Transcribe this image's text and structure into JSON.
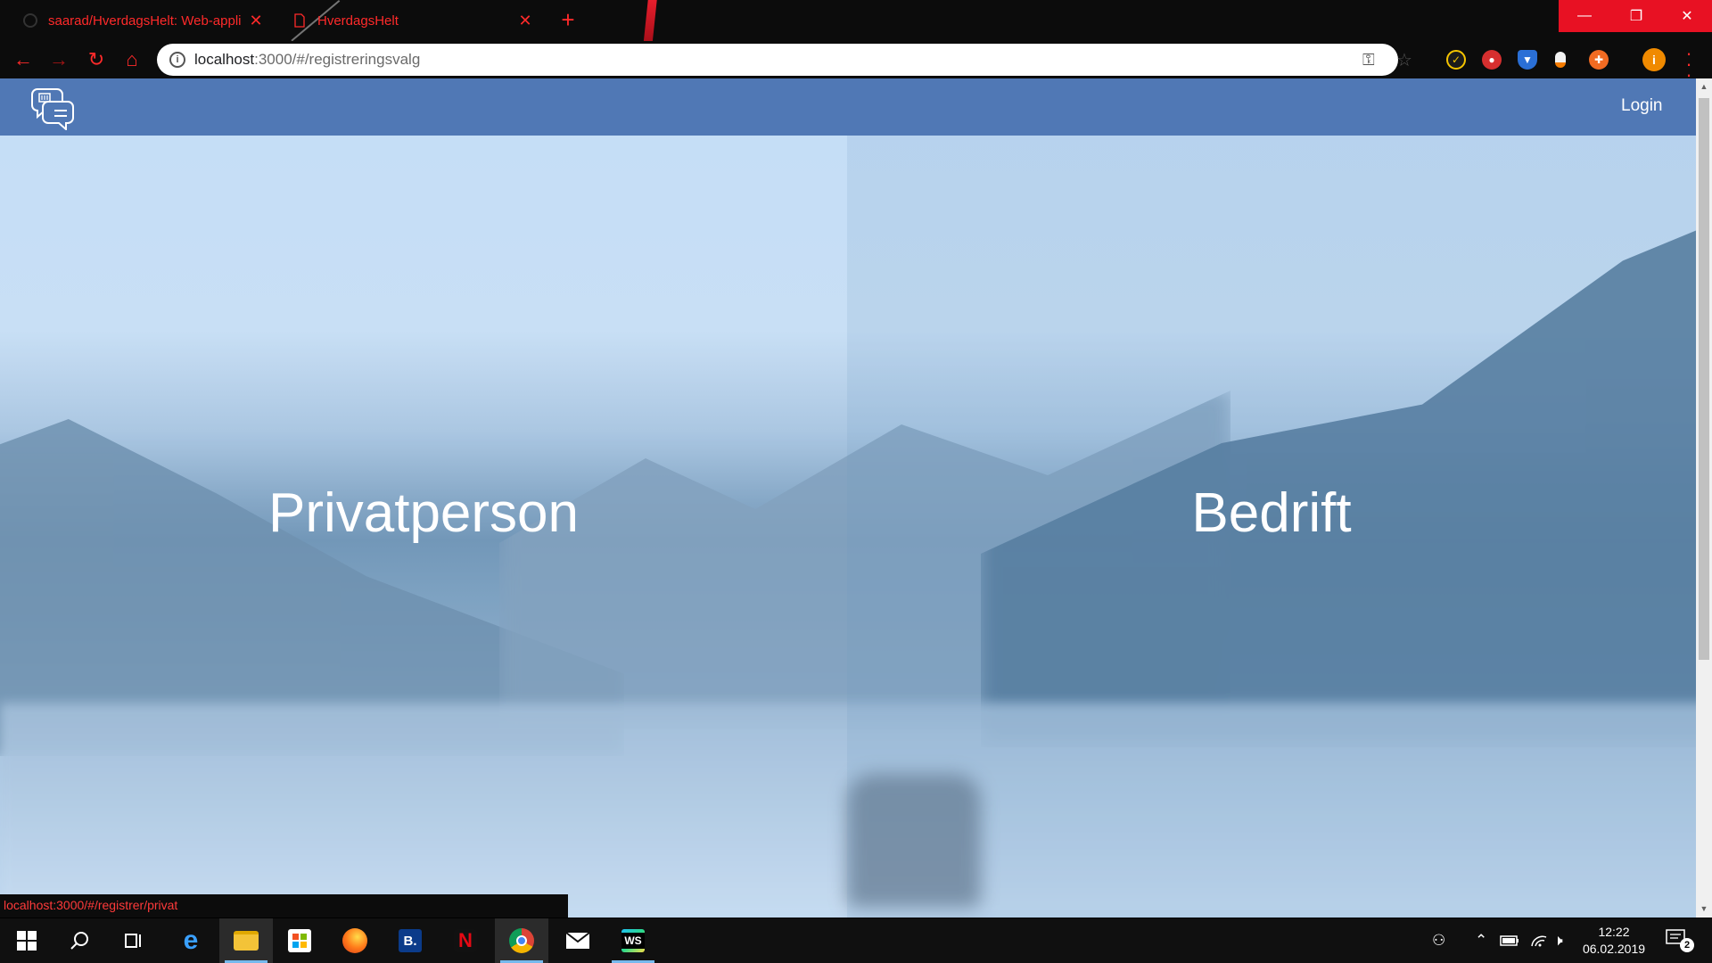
{
  "browser": {
    "tabs": [
      {
        "title": "saarad/HverdagsHelt: Web-appli",
        "close": "✕"
      },
      {
        "title": "HverdagsHelt",
        "close": "✕"
      }
    ],
    "new_tab": "+",
    "url_host": "localhost",
    "url_path": ":3000/#/registreringsvalg",
    "status_url": "localhost:3000/#/registrer/privat",
    "window": {
      "minimize": "—",
      "maximize": "❐",
      "close": "✕"
    }
  },
  "app": {
    "nav": {
      "login_label": "Login"
    },
    "choices": {
      "private_label": "Privatperson",
      "business_label": "Bedrift"
    }
  },
  "taskbar": {
    "clock_time": "12:22",
    "clock_date": "06.02.2019",
    "notification_count": "2",
    "booking_label": "B.",
    "netflix_label": "N",
    "webstorm_label": "WS"
  },
  "colors": {
    "appbar": "#5078b5",
    "accent_red": "#ff2a2a",
    "window_close": "#e81123"
  }
}
